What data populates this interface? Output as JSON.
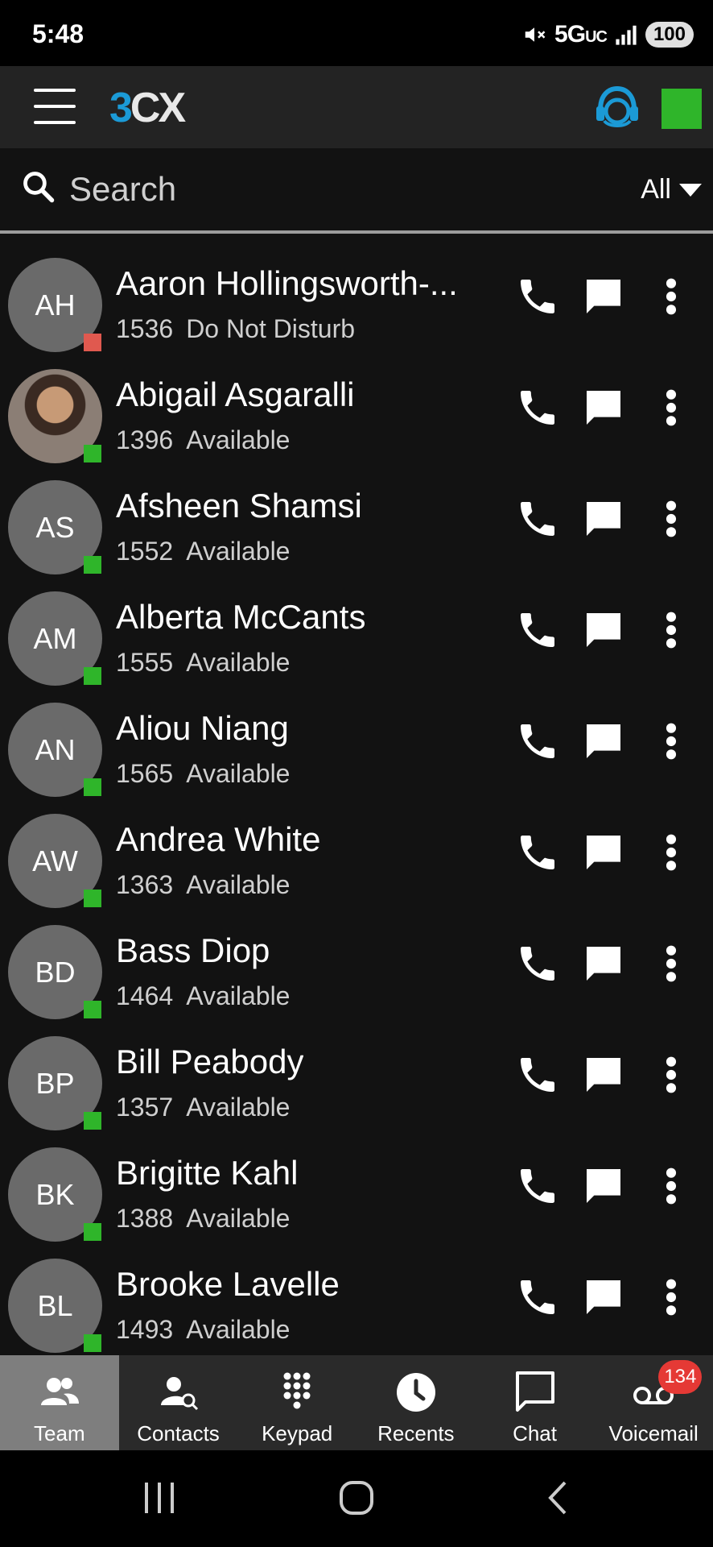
{
  "status_bar": {
    "time": "5:48",
    "network": "5G",
    "network_sub": "UC",
    "battery": "100"
  },
  "app": {
    "logo_3": "3",
    "logo_cx": "CX",
    "status_color": "#2fb52a"
  },
  "search": {
    "placeholder": "Search",
    "filter": "All"
  },
  "contacts": [
    {
      "initials": "AH",
      "name": "Aaron Hollingsworth-...",
      "ext": "1536",
      "status": "Do Not Disturb",
      "presence_color": "#e0594f",
      "photo": false
    },
    {
      "initials": "",
      "name": "Abigail Asgaralli",
      "ext": "1396",
      "status": "Available",
      "presence_color": "#2fb52a",
      "photo": true
    },
    {
      "initials": "AS",
      "name": "Afsheen Shamsi",
      "ext": "1552",
      "status": "Available",
      "presence_color": "#2fb52a",
      "photo": false
    },
    {
      "initials": "AM",
      "name": "Alberta McCants",
      "ext": "1555",
      "status": "Available",
      "presence_color": "#2fb52a",
      "photo": false
    },
    {
      "initials": "AN",
      "name": "Aliou Niang",
      "ext": "1565",
      "status": "Available",
      "presence_color": "#2fb52a",
      "photo": false
    },
    {
      "initials": "AW",
      "name": "Andrea White",
      "ext": "1363",
      "status": "Available",
      "presence_color": "#2fb52a",
      "photo": false
    },
    {
      "initials": "BD",
      "name": "Bass Diop",
      "ext": "1464",
      "status": "Available",
      "presence_color": "#2fb52a",
      "photo": false
    },
    {
      "initials": "BP",
      "name": "Bill Peabody",
      "ext": "1357",
      "status": "Available",
      "presence_color": "#2fb52a",
      "photo": false
    },
    {
      "initials": "BK",
      "name": "Brigitte Kahl",
      "ext": "1388",
      "status": "Available",
      "presence_color": "#2fb52a",
      "photo": false
    },
    {
      "initials": "BL",
      "name": "Brooke Lavelle",
      "ext": "1493",
      "status": "Available",
      "presence_color": "#2fb52a",
      "photo": false
    }
  ],
  "nav": {
    "team": "Team",
    "contacts": "Contacts",
    "keypad": "Keypad",
    "recents": "Recents",
    "chat": "Chat",
    "voicemail": "Voicemail",
    "voicemail_badge": "134"
  }
}
